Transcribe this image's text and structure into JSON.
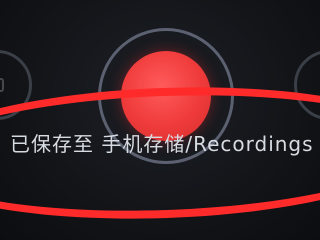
{
  "recorder": {
    "saved_message": "已保存至 手机存储/Recordings"
  },
  "colors": {
    "record_red": "#ef3a3a",
    "annotation_red": "#ff2a2a",
    "background": "#121418"
  },
  "icons": {
    "left_control": "stop-icon",
    "right_control": "list-icon",
    "record": "record-icon"
  }
}
